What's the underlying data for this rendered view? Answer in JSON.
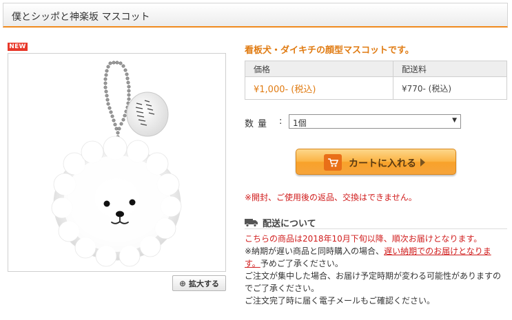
{
  "header": {
    "title": "僕とシッポと神楽坂 マスコット"
  },
  "gallery": {
    "badge": "NEW",
    "zoom_label": "拡大する",
    "zoom_icon": "magnifier-plus-icon"
  },
  "product": {
    "catch_copy": "看板犬・ダイキチの顔型マスコットです。",
    "table_headers": [
      "価格",
      "配送料"
    ],
    "price": "¥1,000- (税込)",
    "shipping_fee": "¥770- (税込)",
    "quantity_label": "数量",
    "quantity_colon": ":",
    "quantity_selected": "1個",
    "quantity_arrow": "▼",
    "cart_label": "カートに入れる",
    "cart_icon": "cart-icon",
    "notice": "※開封、ご使用後の返品、交換はできません。"
  },
  "shipping": {
    "heading": "配送について",
    "heading_icon": "truck-icon",
    "line1": "こちらの商品は2018年10月下旬以降、順次お届けとなります。",
    "line2_prefix": "※納期が遅い商品と同時購入の場合、",
    "line2_link": "遅い納期でのお届けとなりま",
    "line3_link": "す。",
    "line3_suffix": "予めご了承ください。",
    "line4": "ご注文が集中した場合、お届け予定時期が変わる可能性がありますの",
    "line5": "でご了承ください。",
    "line6": "ご注文完了時に届く電子メールもご確認ください。"
  },
  "colors": {
    "accent_orange": "#f08a1c",
    "price_orange": "#e07b12",
    "notice_red": "#d01c1c",
    "new_badge": "#e8382a"
  }
}
